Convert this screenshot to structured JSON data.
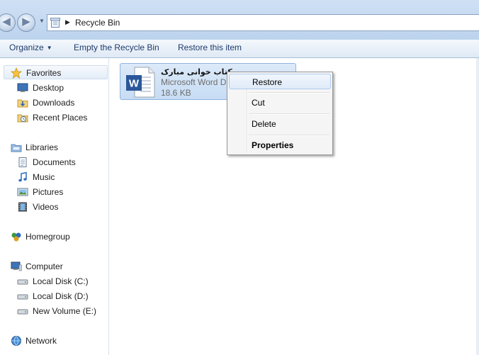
{
  "addressbar": {
    "breadcrumb": "Recycle Bin",
    "icons": [
      "back-arrow-icon",
      "forward-arrow-icon",
      "recycle-bin-icon",
      "breadcrumb-arrow-icon"
    ]
  },
  "toolbar": {
    "organize_label": "Organize",
    "empty_label": "Empty the Recycle Bin",
    "restore_label": "Restore this item"
  },
  "navpane": {
    "favorites": {
      "label": "Favorites",
      "items": [
        {
          "label": "Desktop",
          "icon": "desktop-icon"
        },
        {
          "label": "Downloads",
          "icon": "downloads-folder-icon"
        },
        {
          "label": "Recent Places",
          "icon": "recent-places-icon"
        }
      ]
    },
    "libraries": {
      "label": "Libraries",
      "items": [
        {
          "label": "Documents",
          "icon": "documents-icon"
        },
        {
          "label": "Music",
          "icon": "music-icon"
        },
        {
          "label": "Pictures",
          "icon": "pictures-icon"
        },
        {
          "label": "Videos",
          "icon": "videos-icon"
        }
      ]
    },
    "homegroup": {
      "label": "Homegroup"
    },
    "computer": {
      "label": "Computer",
      "items": [
        {
          "label": "Local Disk (C:)",
          "icon": "drive-icon"
        },
        {
          "label": "Local Disk (D:)",
          "icon": "drive-icon"
        },
        {
          "label": "New Volume (E:)",
          "icon": "drive-icon"
        }
      ]
    },
    "network": {
      "label": "Network"
    }
  },
  "file": {
    "name": "روز کتاب خوانی مبارک",
    "type": "Microsoft Word D",
    "size": "18.6 KB",
    "icon": "word-document-icon"
  },
  "context_menu": {
    "items": [
      "Restore",
      "Cut",
      "Delete",
      "Properties"
    ]
  },
  "colors": {
    "selection": "#cce0f7",
    "toolbar_text": "#1e3b6b",
    "word_blue": "#2b579a"
  }
}
